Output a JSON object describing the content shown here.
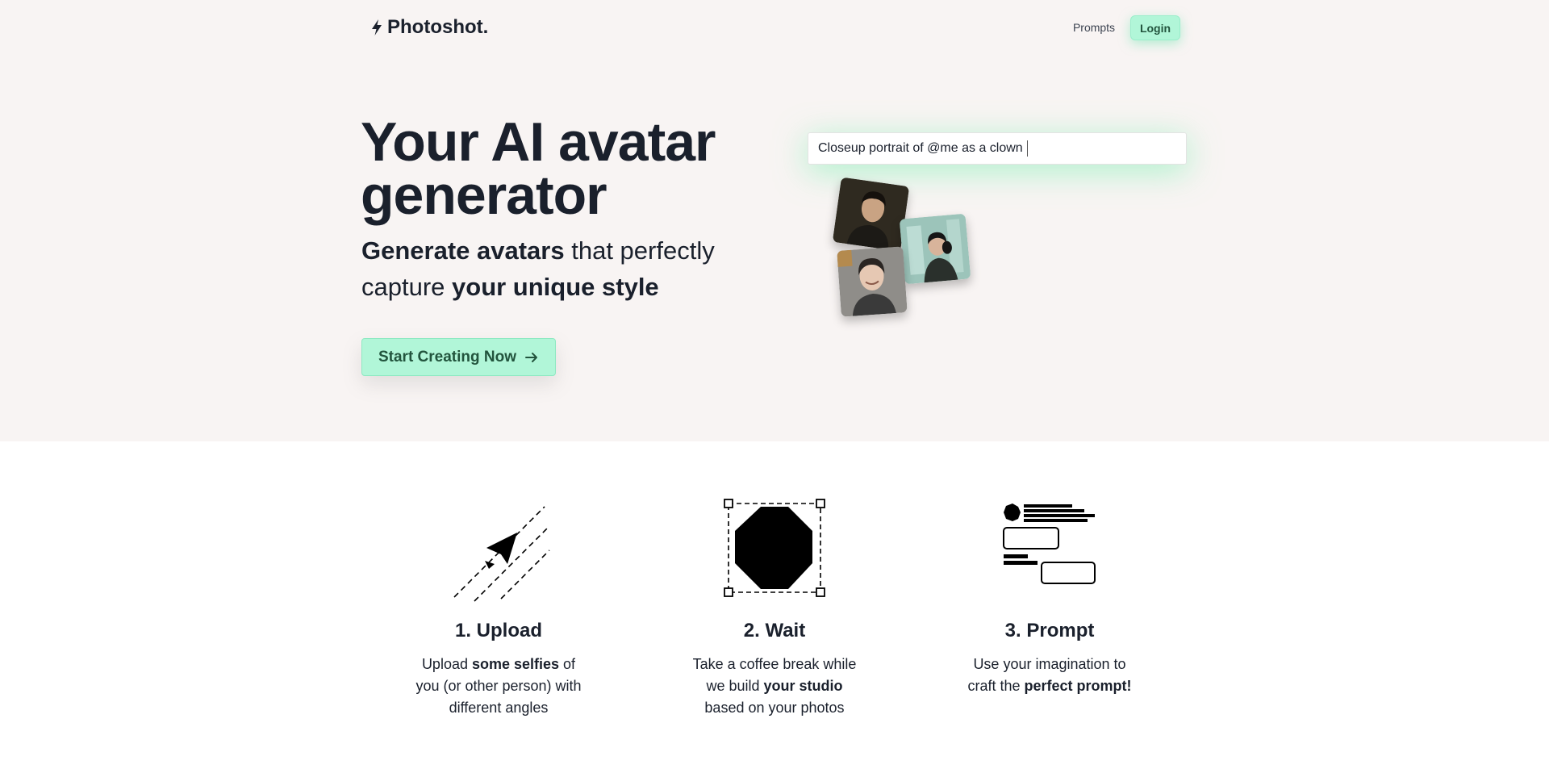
{
  "header": {
    "logo_text": "Photoshot.",
    "logo_icon": "lightning-bolt-icon",
    "nav": {
      "prompts_label": "Prompts",
      "login_label": "Login"
    }
  },
  "hero": {
    "title_line1": "Your AI avatar",
    "title_line2": "generator",
    "subtitle": {
      "part1_bold": "Generate avatars",
      "part2": " that perfectly capture ",
      "part3_bold": "your unique style"
    },
    "cta_label": "Start Creating Now",
    "cta_icon": "arrow-right-icon"
  },
  "demo": {
    "prompt_text": "Closeup portrait of @me as a clown"
  },
  "steps": [
    {
      "title": "1. Upload",
      "icon": "paper-plane-icon",
      "desc_parts": [
        "Upload ",
        "some selfies",
        " of you (or other person) with different angles"
      ]
    },
    {
      "title": "2. Wait",
      "icon": "octagon-selection-icon",
      "desc_parts": [
        "Take a coffee break while we build ",
        "your studio",
        " based on your photos"
      ]
    },
    {
      "title": "3. Prompt",
      "icon": "prompt-layout-icon",
      "desc_parts": [
        "Use your imagination to craft the ",
        "perfect prompt!",
        ""
      ]
    }
  ],
  "colors": {
    "accent": "#b1f6d8",
    "accent_text": "#22543d",
    "hero_bg": "#f8f4f3",
    "text": "#1a202c"
  }
}
